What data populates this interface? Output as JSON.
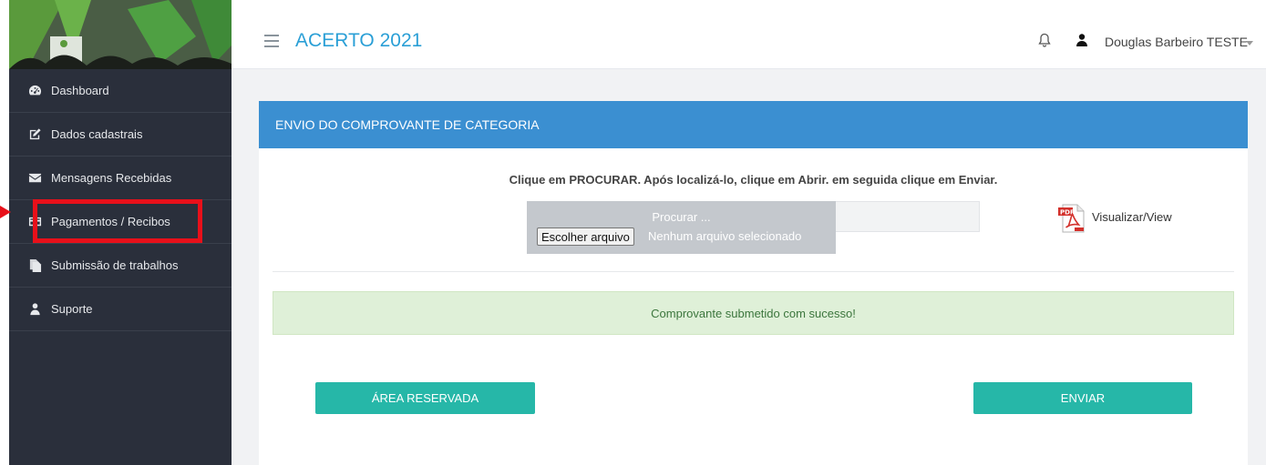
{
  "app": {
    "title": "ACERTO 2021"
  },
  "header": {
    "user_name": "Douglas Barbeiro TESTE"
  },
  "sidebar": {
    "items": [
      {
        "label": "Dashboard",
        "icon": "dashboard-icon"
      },
      {
        "label": "Dados cadastrais",
        "icon": "edit-icon"
      },
      {
        "label": "Mensagens Recebidas",
        "icon": "envelope-icon"
      },
      {
        "label": "Pagamentos / Recibos",
        "icon": "credit-card-icon"
      },
      {
        "label": "Submissão de trabalhos",
        "icon": "files-icon"
      },
      {
        "label": "Suporte",
        "icon": "user-icon"
      }
    ],
    "highlighted_item": "Pagamentos / Recibos"
  },
  "panel": {
    "title": "ENVIO DO COMPROVANTE DE CATEGORIA",
    "instructions": "Clique em PROCURAR. Após localizá-lo, clique em Abrir. em seguida clique em Enviar.",
    "file_placeholder": "Procurar ...",
    "choose_button": "Escolher arquivo",
    "no_file_text": "Nenhum arquivo selecionado",
    "view_link": "Visualizar/View",
    "success_message": "Comprovante submetido com sucesso!",
    "reserved_button": "ÁREA RESERVADA",
    "send_button": "ENVIAR"
  },
  "colors": {
    "accent": "#2a9fd6",
    "panel_header": "#3b8fd1",
    "button": "#26b7a8",
    "sidebar": "#2a2f3b",
    "highlight": "#e8101a",
    "alert_bg": "#dff0d8"
  }
}
